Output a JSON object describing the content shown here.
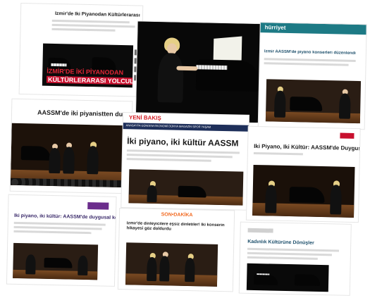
{
  "collage": {
    "c1": {
      "headline": "İzmir'de İki Piyanodan Kültürlerarası",
      "banner_top": "İZMİR'DE İKİ PİYANODAN",
      "banner_bottom": "KÜLTÜRLERARASI YOLCULUK"
    },
    "c3": {
      "brand": "hürriyet",
      "headline": "İzmir AASSM'de piyano konserleri düzenlendi"
    },
    "c4": {
      "headline": "AASSM'de iki piyanistten duygu"
    },
    "c5": {
      "brand": "YENİ BAKIŞ",
      "nav": "ANASAYFA   GÜNDEM   EKONOMİ   DÜNYA   MAGAZİN   SPOR   YAŞAM",
      "headline": "İki piyano, iki kültür AASSM"
    },
    "c6": {
      "headline": "İki Piyano, İki Kültür: AASSM'de Duygusal"
    },
    "c7": {
      "headline": "İki piyano, iki kültür: AASSM'de duygusal konser"
    },
    "c8": {
      "brand": "SON•DAKİKA",
      "headline": "İzmir'de dinleyicilere eşsiz dinletiler! İki konserin hikayesi göz doldurdu"
    },
    "c9": {
      "headline": "Kadınlık Kültürüne Dönüşler"
    }
  },
  "colors": {
    "banner_red": "#c8102e",
    "brand_purple": "#6b2d8c",
    "yeni_red": "#d32027",
    "hurriyet_teal": "#1d7a85",
    "sondakika_orange": "#f26a21"
  }
}
